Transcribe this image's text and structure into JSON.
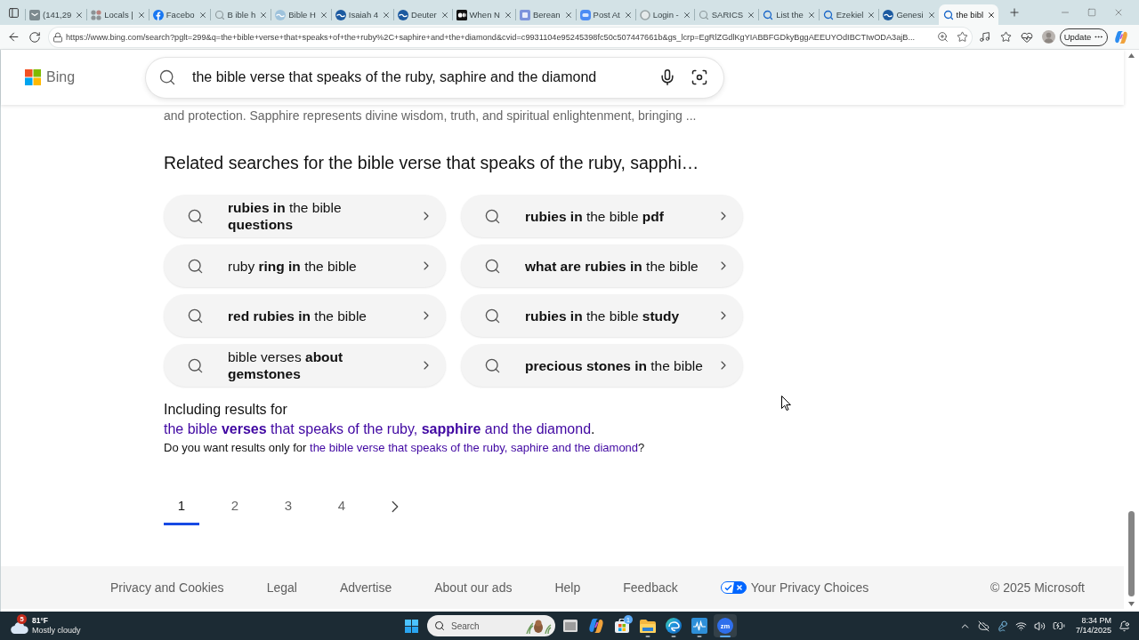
{
  "browser": {
    "tabs": [
      {
        "kind": "mail",
        "title": "(141,29",
        "selected": false
      },
      {
        "kind": "apps",
        "title": "Locals |",
        "selected": false
      },
      {
        "kind": "facebook",
        "title": "Facebo",
        "selected": false
      },
      {
        "kind": "search",
        "title": "B ible h",
        "selected": false
      },
      {
        "kind": "globe",
        "title": "Bible H",
        "selected": false
      },
      {
        "kind": "bible",
        "title": "Isaiah 4",
        "selected": false
      },
      {
        "kind": "bible",
        "title": "Deuter",
        "selected": false
      },
      {
        "kind": "medium",
        "title": "When N",
        "selected": false
      },
      {
        "kind": "berean",
        "title": "Berean",
        "selected": false
      },
      {
        "kind": "zoom",
        "title": "Post At",
        "selected": false
      },
      {
        "kind": "login",
        "title": "Login -",
        "selected": false
      },
      {
        "kind": "search",
        "title": "SARICS",
        "selected": false
      },
      {
        "kind": "bing",
        "title": "List the",
        "selected": false
      },
      {
        "kind": "bing",
        "title": "Ezekiel",
        "selected": false
      },
      {
        "kind": "bible",
        "title": "Genesi",
        "selected": false
      },
      {
        "kind": "bing",
        "title": "the bibl",
        "selected": true
      }
    ],
    "url": "https://www.bing.com/search?pglt=299&q=the+bible+verse+that+speaks+of+the+ruby%2C+saphire+and+the+diamond&cvid=c9931104e95245398fc50c507447661b&gs_lcrp=EgRlZGdlKgYIABBFGDkyBggAEEUYOdIBCTIwODA3ajB...",
    "update_button": "Update"
  },
  "bing": {
    "brand": "Bing",
    "query": "the bible verse that speaks of the ruby, saphire and the diamond"
  },
  "snippet": "and protection. Sapphire represents divine wisdom, truth, and spiritual enlightenment, bringing ...",
  "related": {
    "heading": "Related searches for the bible verse that speaks of the ruby, sapphi…",
    "items": [
      "**rubies in** the bible **questions**",
      "**rubies in** the bible **pdf**",
      "ruby **ring in** the bible",
      "**what are rubies in** the bible",
      "**red rubies in** the bible",
      "**rubies in** the bible **study**",
      "bible verses **about gemstones**",
      "**precious stones in** the bible"
    ]
  },
  "spelling": {
    "prefix": "Including results for",
    "link": "the bible **verses** that speaks of the ruby, **sapphire** and the diamond",
    "suffix": "."
  },
  "alternative": {
    "prefix": "Do you want results only for",
    "link": "the bible verse that speaks of the ruby, saphire and the diamond",
    "suffix": "?"
  },
  "pagination": {
    "pages": [
      {
        "label": "1",
        "selected": true
      },
      {
        "label": "2",
        "selected": false
      },
      {
        "label": "3",
        "selected": false
      },
      {
        "label": "4",
        "selected": false
      }
    ]
  },
  "footer": {
    "links": [
      "Privacy and Cookies",
      "Legal",
      "Advertise",
      "About our ads",
      "Help",
      "Feedback"
    ],
    "privacy_choices": "Your Privacy Choices",
    "copyright": "© 2025 Microsoft"
  },
  "taskbar": {
    "weather": {
      "badge": "5",
      "temperature": "81°F",
      "condition": "Mostly cloudy"
    },
    "search_placeholder": "Search",
    "apps": [
      {
        "kind": "taskview",
        "running": false,
        "selected": false
      },
      {
        "kind": "copilot",
        "running": false,
        "selected": false
      },
      {
        "kind": "store",
        "running": false,
        "selected": false,
        "badge": "1"
      },
      {
        "kind": "explorer",
        "running": true,
        "selected": false
      },
      {
        "kind": "edge",
        "running": true,
        "selected": false
      },
      {
        "kind": "audio",
        "running": true,
        "selected": false
      },
      {
        "kind": "zoom",
        "running": true,
        "selected": true,
        "label": "zm"
      }
    ],
    "time": "8:34 PM",
    "date": "7/14/2025"
  }
}
